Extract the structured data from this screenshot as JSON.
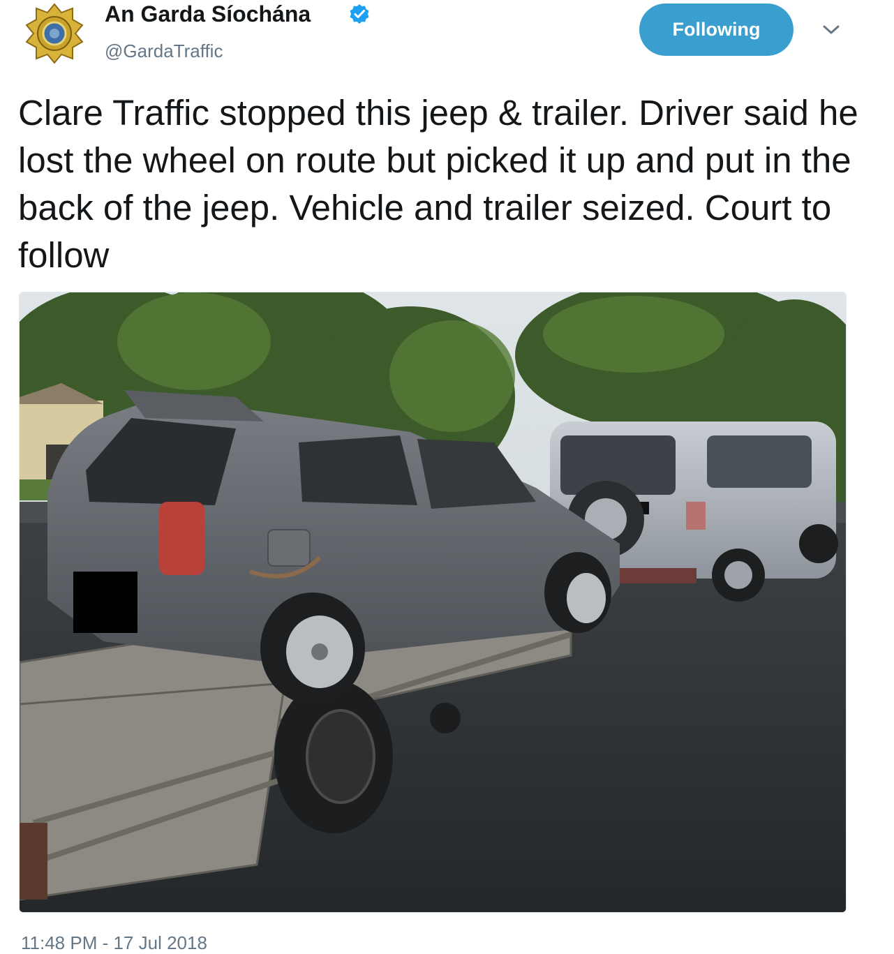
{
  "account": {
    "display_name": "An Garda Síochána",
    "handle": "@GardaTraffic",
    "verified": true,
    "avatar_icon": "garda-badge-icon",
    "verified_icon": "verified-badge-icon"
  },
  "follow_button": {
    "label": "Following",
    "color": "#3a9fcf"
  },
  "menu": {
    "icon": "chevron-down-icon"
  },
  "tweet": {
    "text": "Clare Traffic stopped this jeep & trailer. Driver said he lost the wheel on route but picked it up and put in the back of the jeep. Vehicle and trailer seized. Court to follow",
    "timestamp": "11:48 PM - 17 Jul 2018"
  },
  "media": {
    "description_icon": "photo-car-on-trailer-towed-by-jeep"
  },
  "colors": {
    "accent": "#1da1f2",
    "secondary_text": "#657786"
  }
}
